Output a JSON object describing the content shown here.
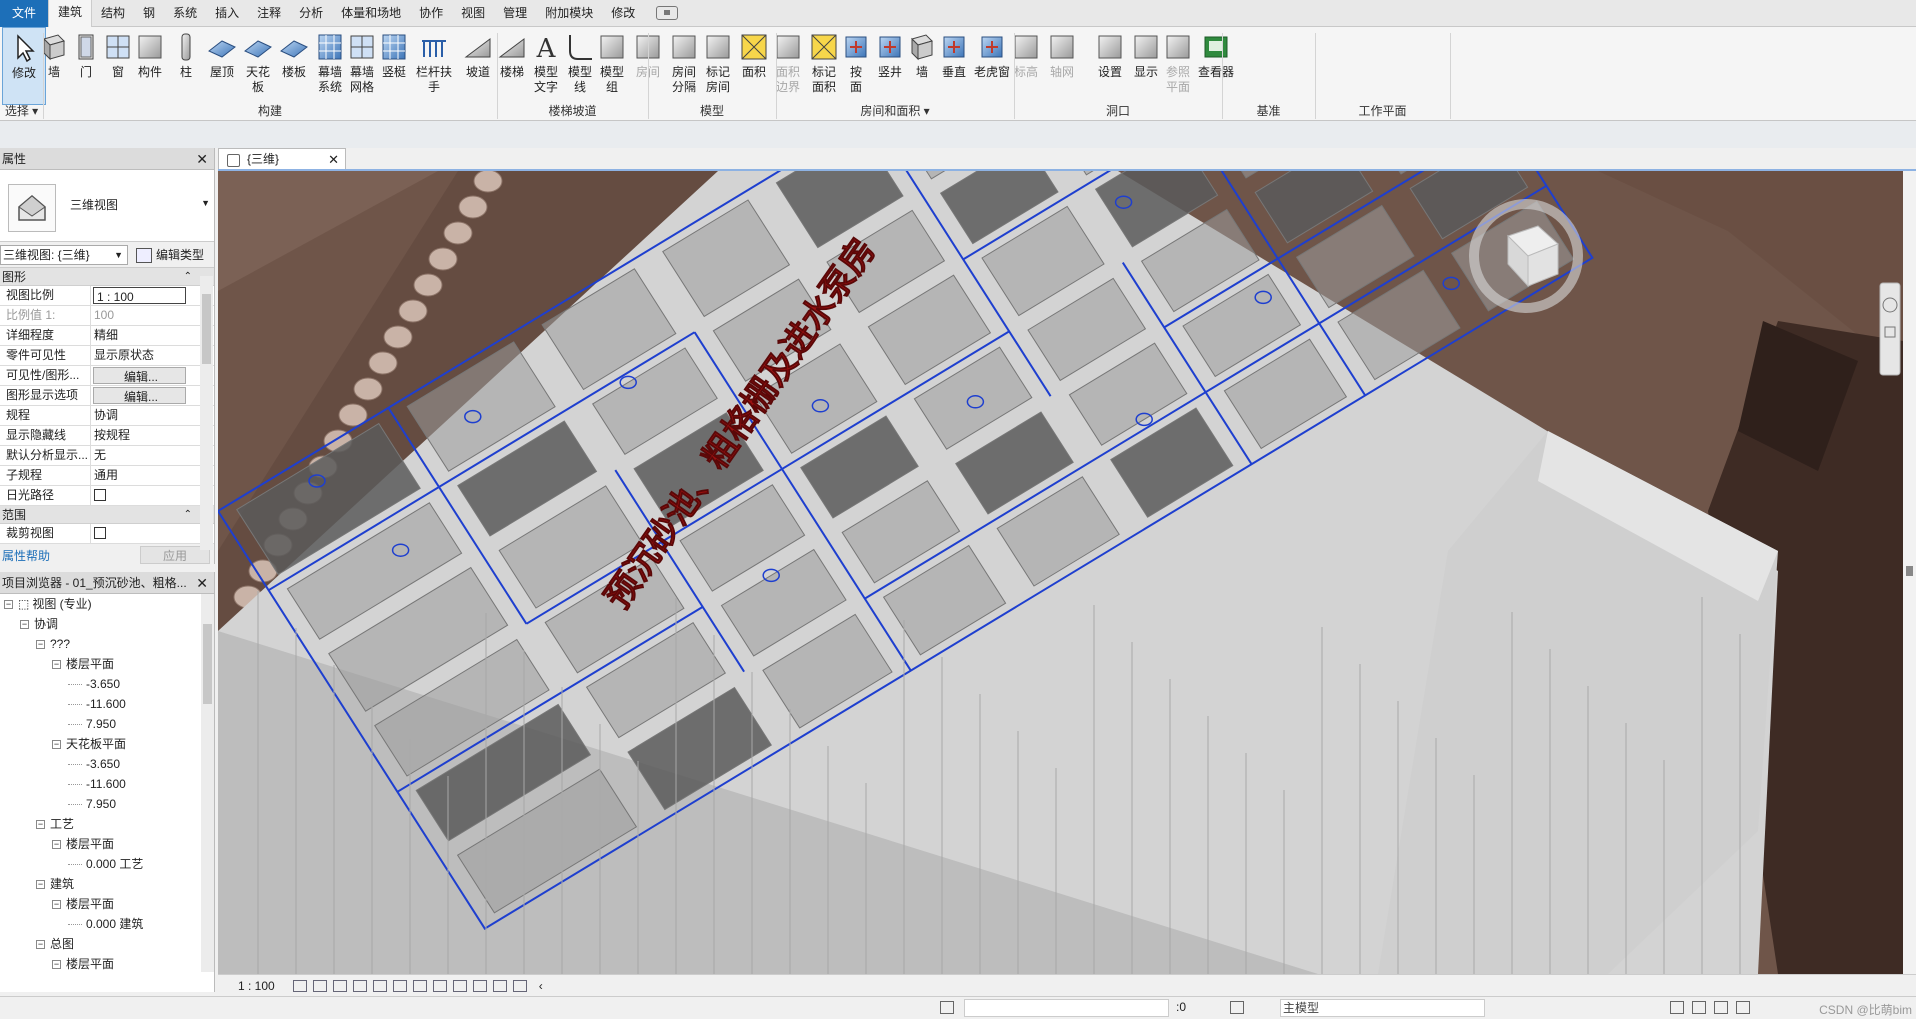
{
  "tabs": [
    "文件",
    "建筑",
    "结构",
    "钢",
    "系统",
    "插入",
    "注释",
    "分析",
    "体量和场地",
    "协作",
    "视图",
    "管理",
    "附加模块",
    "修改"
  ],
  "active_tab": "建筑",
  "ribbon": {
    "buttons": [
      {
        "label": "修改",
        "name": "modify"
      },
      {
        "label": "墙",
        "name": "wall"
      },
      {
        "label": "门",
        "name": "door"
      },
      {
        "label": "窗",
        "name": "window"
      },
      {
        "label": "构件",
        "name": "component"
      },
      {
        "label": "柱",
        "name": "column"
      },
      {
        "label": "屋顶",
        "name": "roof"
      },
      {
        "label": "天花板",
        "name": "ceiling"
      },
      {
        "label": "楼板",
        "name": "floor"
      },
      {
        "label": "幕墙\n系统",
        "name": "curtain-system"
      },
      {
        "label": "幕墙\n网格",
        "name": "curtain-grid"
      },
      {
        "label": "竖梃",
        "name": "mullion"
      },
      {
        "label": "栏杆扶手",
        "name": "railing"
      },
      {
        "label": "坡道",
        "name": "ramp"
      },
      {
        "label": "楼梯",
        "name": "stair"
      },
      {
        "label": "模型\n文字",
        "name": "model-text"
      },
      {
        "label": "模型\n线",
        "name": "model-line"
      },
      {
        "label": "模型\n组",
        "name": "model-group"
      },
      {
        "label": "房间",
        "name": "room"
      },
      {
        "label": "房间\n分隔",
        "name": "room-separator"
      },
      {
        "label": "标记\n房间",
        "name": "tag-room"
      },
      {
        "label": "面积",
        "name": "area"
      },
      {
        "label": "面积\n边界",
        "name": "area-boundary"
      },
      {
        "label": "标记\n面积",
        "name": "tag-area"
      },
      {
        "label": "按\n面",
        "name": "by-face"
      },
      {
        "label": "竖井",
        "name": "shaft"
      },
      {
        "label": "墙",
        "name": "wall-opening"
      },
      {
        "label": "垂直",
        "name": "vertical"
      },
      {
        "label": "老虎窗",
        "name": "dormer"
      },
      {
        "label": "标高",
        "name": "level"
      },
      {
        "label": "轴网",
        "name": "grid"
      },
      {
        "label": "设置",
        "name": "set"
      },
      {
        "label": "显示",
        "name": "show"
      },
      {
        "label": "参照\n平面",
        "name": "ref-plane"
      },
      {
        "label": "查看器",
        "name": "viewer"
      }
    ],
    "groups": {
      "select": "选择",
      "build": "构建",
      "circulation": "楼梯坡道",
      "model": "模型",
      "room_area": "房间和面积",
      "opening": "洞口",
      "datum": "基准",
      "workplane": "工作平面"
    }
  },
  "properties": {
    "title": "属性",
    "type_name": "三维视图",
    "selector": "三维视图: {三维}",
    "edit_type": "编辑类型",
    "section_graphics": "图形",
    "rows": [
      {
        "k": "视图比例",
        "v": "1 : 100",
        "kind": "input"
      },
      {
        "k": "比例值 1:",
        "v": "100",
        "kind": "gray"
      },
      {
        "k": "详细程度",
        "v": "精细"
      },
      {
        "k": "零件可见性",
        "v": "显示原状态"
      },
      {
        "k": "可见性/图形...",
        "v": "编辑...",
        "kind": "edit"
      },
      {
        "k": "图形显示选项",
        "v": "编辑...",
        "kind": "edit"
      },
      {
        "k": "规程",
        "v": "协调"
      },
      {
        "k": "显示隐藏线",
        "v": "按规程"
      },
      {
        "k": "默认分析显示...",
        "v": "无"
      },
      {
        "k": "子规程",
        "v": "通用"
      },
      {
        "k": "日光路径",
        "v": "",
        "kind": "check"
      }
    ],
    "section_range": "范围",
    "range_rows": [
      {
        "k": "裁剪视图",
        "v": "",
        "kind": "check"
      }
    ],
    "help": "属性帮助",
    "apply": "应用"
  },
  "browser": {
    "title": "项目浏览器 - 01_预沉砂池、粗格...",
    "tree": [
      {
        "lvl": 0,
        "t": "视图 (专业)",
        "tg": "−",
        "icon": true
      },
      {
        "lvl": 1,
        "t": "协调",
        "tg": "−"
      },
      {
        "lvl": 2,
        "t": "???",
        "tg": "−"
      },
      {
        "lvl": 3,
        "t": "楼层平面",
        "tg": "−"
      },
      {
        "lvl": 4,
        "t": "-3.650"
      },
      {
        "lvl": 4,
        "t": "-11.600"
      },
      {
        "lvl": 4,
        "t": "7.950"
      },
      {
        "lvl": 3,
        "t": "天花板平面",
        "tg": "−"
      },
      {
        "lvl": 4,
        "t": "-3.650"
      },
      {
        "lvl": 4,
        "t": "-11.600"
      },
      {
        "lvl": 4,
        "t": "7.950"
      },
      {
        "lvl": 2,
        "t": "工艺",
        "tg": "−"
      },
      {
        "lvl": 3,
        "t": "楼层平面",
        "tg": "−"
      },
      {
        "lvl": 4,
        "t": "0.000 工艺"
      },
      {
        "lvl": 2,
        "t": "建筑",
        "tg": "−"
      },
      {
        "lvl": 3,
        "t": "楼层平面",
        "tg": "−"
      },
      {
        "lvl": 4,
        "t": "0.000 建筑"
      },
      {
        "lvl": 2,
        "t": "总图",
        "tg": "−"
      },
      {
        "lvl": 3,
        "t": "楼层平面",
        "tg": "−"
      }
    ]
  },
  "view_tab": "{三维}",
  "model_text": "预沉砂池、粗格栅及进水泵房",
  "viewbar": {
    "scale": "1 : 100"
  },
  "status": {
    "count": ":0",
    "model": "主模型",
    "watermark": "CSDN @比萌bim"
  },
  "colors": {
    "file_tab": "#1d6fb8",
    "edge": "#1e3fcf",
    "ground": "#6f5549",
    "text3d": "#9b1010"
  }
}
